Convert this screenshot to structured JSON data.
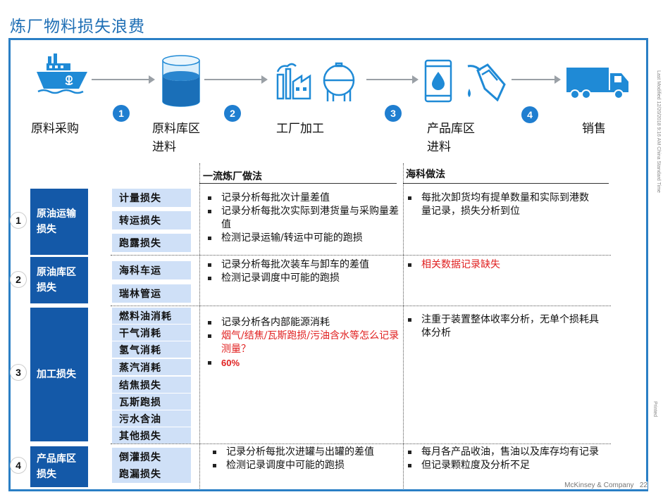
{
  "title": "炼厂物料损失浪费",
  "sidebar": {
    "modified": "Last Modified 12/20/2018 9:16 AM China Standard Time",
    "printed": "Printed"
  },
  "process": {
    "steps": [
      {
        "label_line1": "原料采购",
        "label_line2": ""
      },
      {
        "label_line1": "原料库区",
        "label_line2": "进料"
      },
      {
        "label_line1": "工厂加工",
        "label_line2": ""
      },
      {
        "label_line1": "产品库区",
        "label_line2": "进料"
      },
      {
        "label_line1": "销售",
        "label_line2": ""
      }
    ],
    "numbers": [
      "1",
      "2",
      "3",
      "4"
    ]
  },
  "columns": {
    "best_practice": "一流炼厂做法",
    "company_practice": "海科做法"
  },
  "sections": [
    {
      "num": "1",
      "category": "原油运输损失",
      "items": [
        "计量损失",
        "转运损失",
        "跑露损失"
      ],
      "best": [
        "记录分析每批次计量差值",
        "记录分析每批次实际到港货量与采购量差值",
        "检测记录运输/转运中可能的跑损"
      ],
      "company": [
        "每批次卸货均有提单数量和实际到港数量记录，损失分析到位"
      ]
    },
    {
      "num": "2",
      "category": "原油库区损失",
      "items": [
        "海科车运",
        "瑞林管运"
      ],
      "best": [
        "记录分析每批次装车与卸车的差值",
        "检测记录调度中可能的跑损"
      ],
      "company": [
        "相关数据记录缺失"
      ]
    },
    {
      "num": "3",
      "category": "加工损失",
      "items": [
        "燃料油消耗",
        "干气消耗",
        "氢气消耗",
        "蒸汽消耗",
        "结焦损失",
        "瓦斯跑损",
        "污水含油",
        "其他损失"
      ],
      "best": [
        "记录分析各内部能源消耗",
        "烟气/结焦/瓦斯跑损/污油含水等怎么记录测量？",
        "60%"
      ],
      "company": [
        "注重于装置整体收率分析，无单个损耗具体分析"
      ]
    },
    {
      "num": "4",
      "category": "产品库区损失",
      "items": [
        "倒灌损失",
        "跑漏损失"
      ],
      "best": [
        "记录分析每批次进罐与出罐的差值",
        "检测记录调度中可能的跑损"
      ],
      "company": [
        "每月各产品收油，售油以及库存均有记录",
        "但记录颗粒度及分析不足"
      ]
    }
  ],
  "footer": {
    "company": "McKinsey & Company",
    "page": "22"
  },
  "colors": {
    "accent": "#1f6fb5",
    "category_bg": "#1459a8",
    "item_bg": "#cfe0f7",
    "highlight": "#e02020"
  },
  "icons": [
    "ship-icon",
    "tank-icon",
    "factory-icon",
    "sphere-tank-icon",
    "oil-barrel-icon",
    "fuel-nozzle-icon",
    "truck-icon"
  ]
}
